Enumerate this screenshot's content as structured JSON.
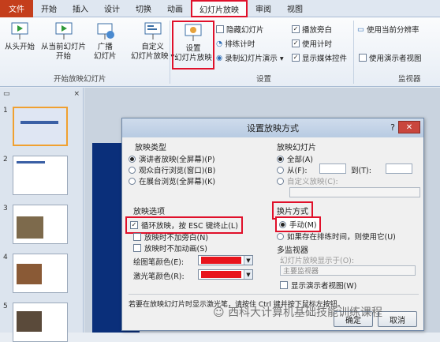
{
  "ribbon_tabs": {
    "file": "文件",
    "items": [
      "开始",
      "插入",
      "设计",
      "切换",
      "动画",
      "幻灯片放映",
      "审阅",
      "视图"
    ]
  },
  "ribbon": {
    "start_group": {
      "from_start": "从头开始",
      "from_current_l1": "从当前幻灯片",
      "from_current_l2": "开始",
      "broadcast_l1": "广播",
      "broadcast_l2": "幻灯片",
      "custom_l1": "自定义",
      "custom_l2": "幻灯片放映 ▾",
      "label": "开始放映幻灯片"
    },
    "setup_group": {
      "setup_l1": "设置",
      "setup_l2": "幻灯片放映",
      "hide_slide": "隐藏幻灯片",
      "rehearse": "排练计时",
      "record": "录制幻灯片演示 ▾",
      "play_narration": "播放旁白",
      "use_timings": "使用计时",
      "show_media": "显示媒体控件",
      "label": "设置"
    },
    "monitor_group": {
      "resolution": "使用当前分辨率",
      "presenter_view": "使用演示者视图",
      "label": "监视器"
    }
  },
  "slides_panel": {
    "numbers": [
      "1",
      "2",
      "3",
      "4",
      "5"
    ],
    "close": "×"
  },
  "dialog": {
    "title": "设置放映方式",
    "help": "?",
    "close": "✕",
    "show_type": {
      "title": "放映类型",
      "options": [
        "演讲者放映(全屏幕)(P)",
        "观众自行浏览(窗口)(B)",
        "在展台浏览(全屏幕)(K)"
      ]
    },
    "show_slides": {
      "title": "放映幻灯片",
      "all": "全部(A)",
      "from": "从(F):",
      "to": "到(T):",
      "custom": "自定义放映(C):"
    },
    "show_options": {
      "title": "放映选项",
      "loop": "循环放映，按 ESC 键终止(L)",
      "no_narration": "放映时不加旁白(N)",
      "no_animation": "放映时不加动画(S)",
      "pen_color": "绘图笔颜色(E):",
      "laser_color": "激光笔颜色(R):"
    },
    "advance": {
      "title": "换片方式",
      "manual": "手动(M)",
      "timings": "如果存在排练时间，则使用它(U)"
    },
    "multi_monitor": {
      "title": "多监视器",
      "display_on": "幻灯片放映显示于(O):",
      "primary": "主要监视器",
      "presenter": "显示演示者视图(W)"
    },
    "footer_note": "若要在放映幻灯片时显示激光笔，请按住 Ctrl 键并按下鼠标左按钮。",
    "ok": "确定",
    "cancel": "取消"
  },
  "watermark": "西科大计算机基础技能训练课程",
  "colors": {
    "accent": "#c43e1c",
    "highlight": "#e0102a",
    "pen": "#e8141c"
  }
}
